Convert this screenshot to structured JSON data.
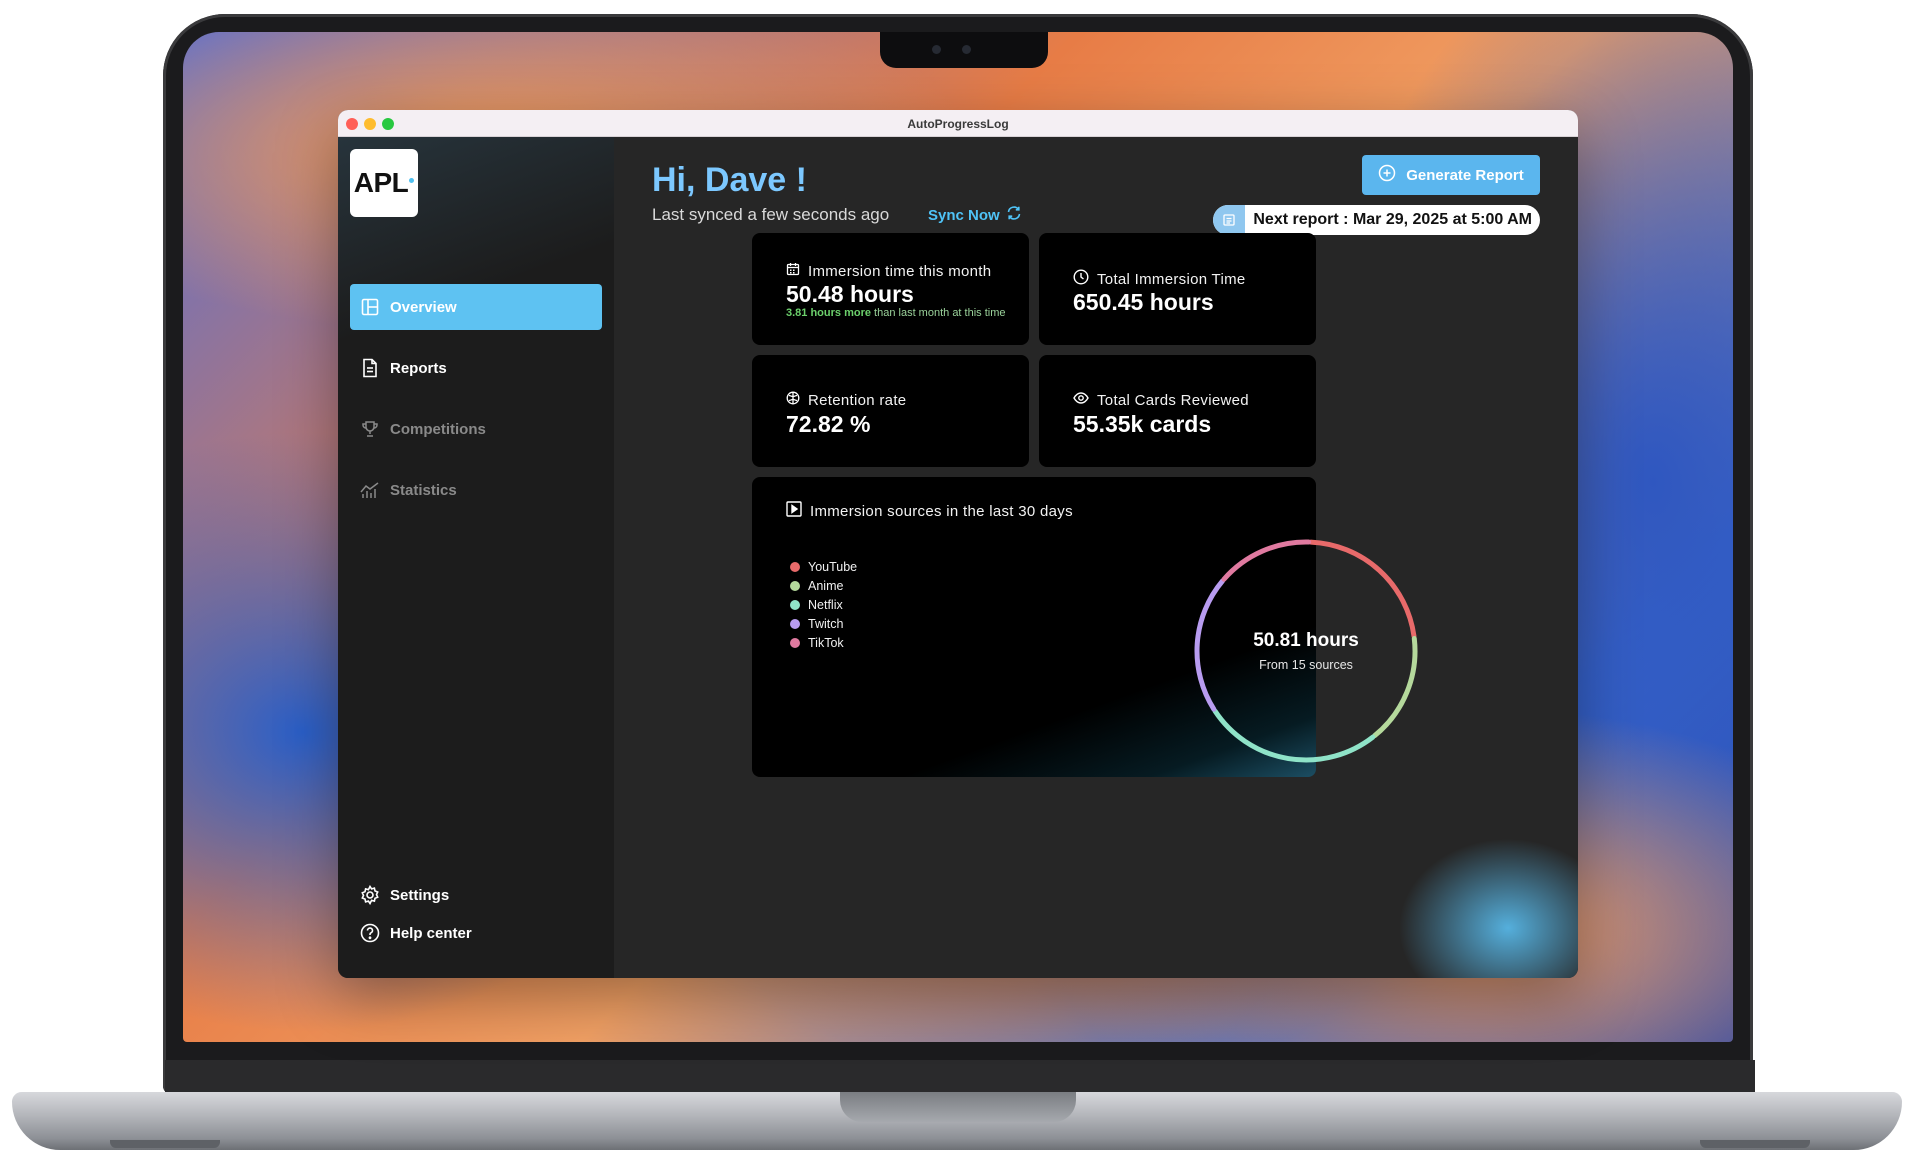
{
  "window": {
    "title": "AutoProgressLog"
  },
  "sidebar": {
    "logo_text": "APL",
    "items": [
      {
        "label": "Overview",
        "icon": "layout-icon",
        "active": true
      },
      {
        "label": "Reports",
        "icon": "document-icon",
        "active": false
      },
      {
        "label": "Competitions",
        "icon": "trophy-icon",
        "active": false,
        "disabled": true
      },
      {
        "label": "Statistics",
        "icon": "stats-icon",
        "active": false,
        "disabled": true
      }
    ],
    "footer": [
      {
        "label": "Settings",
        "icon": "gear-icon"
      },
      {
        "label": "Help center",
        "icon": "help-icon"
      }
    ]
  },
  "header": {
    "greeting": "Hi, Dave !",
    "last_synced": "Last synced a few seconds ago",
    "sync_now": "Sync Now",
    "generate_report": "Generate Report",
    "next_report": "Next report : Mar 29, 2025 at 5:00 AM"
  },
  "stats": {
    "immersion_month": {
      "label": "Immersion time this month",
      "value": "50.48 hours",
      "delta_bold": "3.81 hours more",
      "delta_rest": "than last month at this time"
    },
    "total_immersion": {
      "label": "Total Immersion Time",
      "value": "650.45 hours"
    },
    "retention": {
      "label": "Retention rate",
      "value": "72.82 %"
    },
    "cards_reviewed": {
      "label": "Total Cards Reviewed",
      "value": "55.35k cards"
    }
  },
  "sources": {
    "title": "Immersion sources in the last 30 days",
    "total": "50.81 hours",
    "subtitle": "From 15 sources"
  },
  "chart_data": {
    "type": "pie",
    "title": "Immersion sources in the last 30 days",
    "legend_position": "left",
    "categories": [
      "YouTube",
      "Anime",
      "Netflix",
      "Twitch",
      "TikTok"
    ],
    "values": [
      11,
      8,
      13,
      10,
      7
    ],
    "colors": [
      "#e86a6a",
      "#b5d99c",
      "#8fe3c8",
      "#b89cf0",
      "#e07aa0"
    ],
    "inner_label": "50.81 hours",
    "inner_sublabel": "From 15 sources"
  },
  "colors": {
    "accent": "#5ec2f2",
    "greeting": "#7cc8ff",
    "card_bg": "#000000",
    "main_bg": "#262626"
  }
}
